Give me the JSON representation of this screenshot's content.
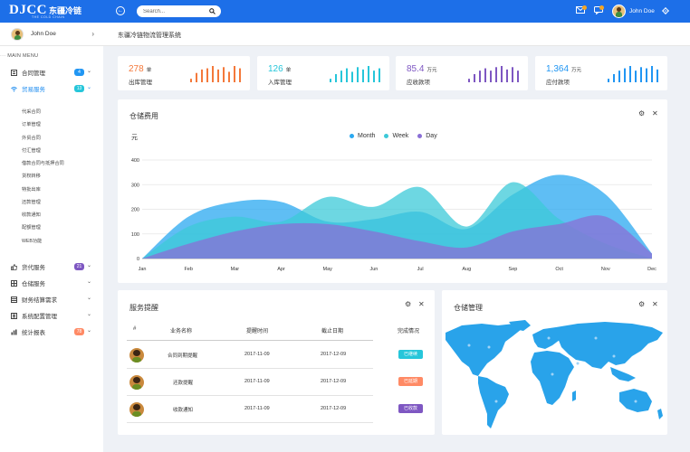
{
  "app": {
    "logo_main": "DJCC",
    "logo_cn": "东疆冷链",
    "logo_sub": "THE COLD CHAIN",
    "search_placeholder": "Search...",
    "user_name": "John Doe"
  },
  "sidebar": {
    "user_name": "John Doe",
    "main_menu_label": "MAIN MENU",
    "items": [
      {
        "label": "合同管理",
        "badge": "4",
        "badge_color": "#2196f3",
        "active": false
      },
      {
        "label": "贸易服务",
        "badge": "13",
        "badge_color": "#26c6da",
        "active": true
      },
      {
        "label": "货代服务",
        "badge": "21",
        "badge_color": "#7e57c2",
        "active": false
      },
      {
        "label": "仓储服务",
        "badge": "",
        "active": false
      },
      {
        "label": "财务结算需求",
        "badge": "",
        "active": false
      },
      {
        "label": "系统配置管理",
        "badge": "",
        "active": false
      },
      {
        "label": "统计报表",
        "badge": "78",
        "badge_color": "#ff8a65",
        "active": false
      }
    ],
    "sub_items": [
      "代采合同",
      "订单管理",
      "外贸合同",
      "付汇管理",
      "借款合同与抵押合同",
      "货权转移",
      "特批出库",
      "还款管理",
      "收款通知",
      "配额管理",
      "WEB功能"
    ]
  },
  "header": {
    "title": "东疆冷链物流管理系统"
  },
  "stats": [
    {
      "value": "278",
      "unit": "单",
      "label": "出库管理",
      "color": "#f4793b",
      "bars": [
        3,
        8,
        11,
        12,
        14,
        11,
        13,
        9,
        14,
        12
      ]
    },
    {
      "value": "126",
      "unit": "单",
      "label": "入库管理",
      "color": "#26c6da",
      "bars": [
        3,
        7,
        10,
        12,
        9,
        13,
        11,
        14,
        10,
        12
      ]
    },
    {
      "value": "85.4",
      "unit": "万元",
      "label": "应收款项",
      "color": "#7e57c2",
      "bars": [
        3,
        7,
        10,
        12,
        10,
        13,
        14,
        11,
        13,
        10
      ]
    },
    {
      "value": "1,364",
      "unit": "万元",
      "label": "应付款项",
      "color": "#2196f3",
      "bars": [
        3,
        7,
        10,
        12,
        14,
        10,
        13,
        12,
        14,
        11
      ]
    }
  ],
  "chart_panel": {
    "title": "仓储费用"
  },
  "chart_data": {
    "type": "area",
    "ylabel": "元",
    "categories": [
      "Jan",
      "Feb",
      "Mar",
      "Apr",
      "May",
      "Jun",
      "Jul",
      "Aug",
      "Sep",
      "Oct",
      "Nov",
      "Dec"
    ],
    "ylim": [
      0,
      400
    ],
    "yticks": [
      0,
      100,
      200,
      300,
      400
    ],
    "legend_position": "top-center",
    "grid": true,
    "series": [
      {
        "name": "Month",
        "color": "#2aa8f0",
        "values": [
          0,
          170,
          230,
          230,
          150,
          160,
          190,
          120,
          260,
          340,
          260,
          20
        ]
      },
      {
        "name": "Week",
        "color": "#3cc9d8",
        "values": [
          0,
          130,
          170,
          150,
          250,
          210,
          290,
          130,
          310,
          160,
          60,
          0
        ]
      },
      {
        "name": "Day",
        "color": "#8a6fd6",
        "values": [
          0,
          60,
          110,
          140,
          140,
          110,
          70,
          45,
          110,
          140,
          170,
          20
        ]
      }
    ]
  },
  "service_panel": {
    "title": "服务提醒",
    "headers": [
      "#",
      "业务名称",
      "提醒时间",
      "截止日期",
      "完成情况"
    ],
    "rows": [
      {
        "name": "合同到期提醒",
        "remind": "2017-11-09",
        "deadline": "2017-12-09",
        "status": "已继续",
        "status_color": "#26c6da"
      },
      {
        "name": "还款提醒",
        "remind": "2017-11-09",
        "deadline": "2017-12-09",
        "status": "已延期",
        "status_color": "#ff8a65"
      },
      {
        "name": "收款通知",
        "remind": "2017-11-09",
        "deadline": "2017-12-09",
        "status": "已收款",
        "status_color": "#7e57c2"
      }
    ]
  },
  "warehouse_panel": {
    "title": "仓储管理",
    "map_color": "#29a3ea"
  }
}
